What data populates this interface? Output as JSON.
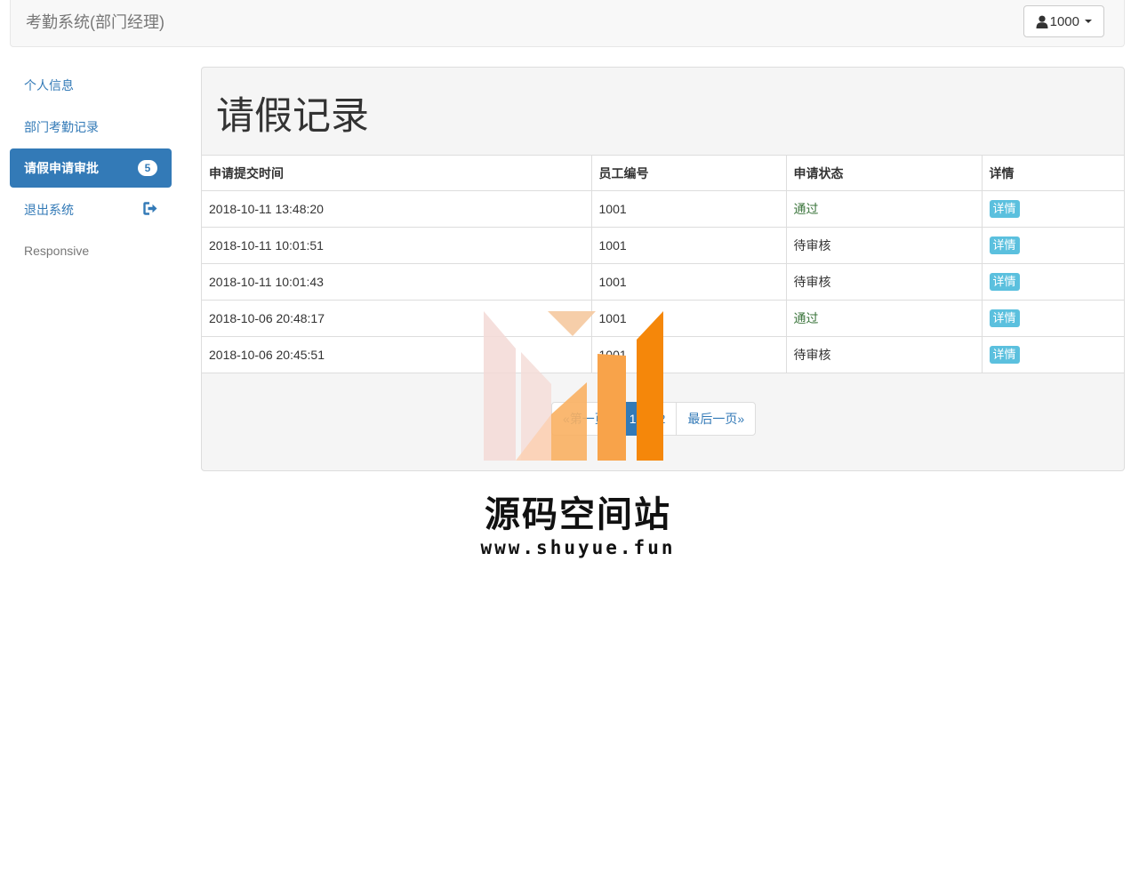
{
  "navbar": {
    "brand": "考勤系统(部门经理)",
    "user_label": "1000"
  },
  "sidebar": {
    "items": [
      {
        "label": "个人信息"
      },
      {
        "label": "部门考勤记录"
      },
      {
        "label": "请假申请审批",
        "badge": "5"
      },
      {
        "label": "退出系统"
      },
      {
        "label": "Responsive"
      }
    ]
  },
  "main": {
    "title": "请假记录",
    "table": {
      "headers": [
        "申请提交时间",
        "员工编号",
        "申请状态",
        "详情"
      ],
      "rows": [
        {
          "time": "2018-10-11 13:48:20",
          "employee_id": "1001",
          "status": "通过",
          "action": "详情"
        },
        {
          "time": "2018-10-11 10:01:51",
          "employee_id": "1001",
          "status": "待审核",
          "action": "详情"
        },
        {
          "time": "2018-10-11 10:01:43",
          "employee_id": "1001",
          "status": "待审核",
          "action": "详情"
        },
        {
          "time": "2018-10-06 20:48:17",
          "employee_id": "1001",
          "status": "通过",
          "action": "详情"
        },
        {
          "time": "2018-10-06 20:45:51",
          "employee_id": "1001",
          "status": "待审核",
          "action": "详情"
        }
      ]
    },
    "pagination": {
      "first": "«第一页",
      "pages": [
        "1",
        "2"
      ],
      "current": "1",
      "last": "最后一页»"
    }
  },
  "watermark": {
    "name": "源码空间站",
    "url": "www.shuyue.fun"
  },
  "colors": {
    "primary": "#337ab7",
    "info": "#5bc0de",
    "success_text": "#3c763d",
    "watermark_orange": "#f5870a"
  }
}
